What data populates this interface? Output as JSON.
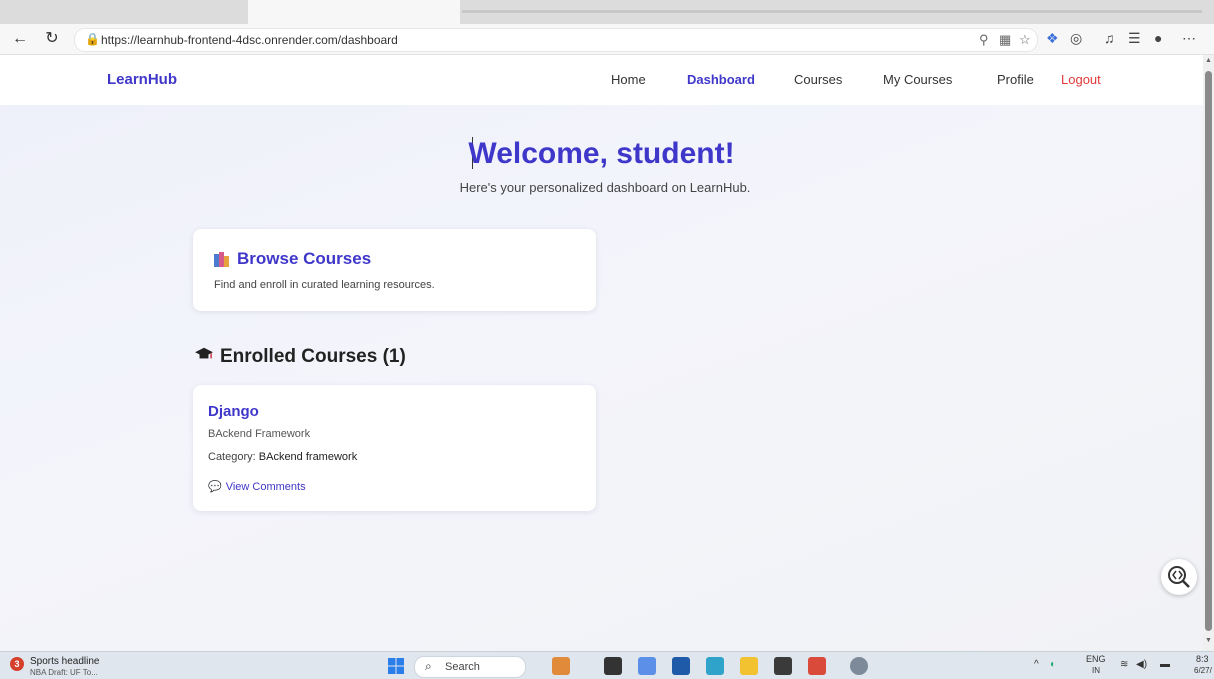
{
  "browser": {
    "url": "https://learnhub-frontend-4dsc.onrender.com/dashboard"
  },
  "nav": {
    "brand": "LearnHub",
    "links": [
      {
        "label": "Home"
      },
      {
        "label": "Dashboard"
      },
      {
        "label": "Courses"
      },
      {
        "label": "My Courses"
      },
      {
        "label": "Profile"
      },
      {
        "label": "Logout"
      }
    ]
  },
  "hero": {
    "title": "Welcome, student!",
    "subtitle": "Here's your personalized dashboard on LearnHub."
  },
  "browse_card": {
    "icon": "books-icon",
    "title": "Browse Courses",
    "description": "Find and enroll in curated learning resources."
  },
  "enrolled": {
    "icon": "graduation-cap-icon",
    "heading": "Enrolled Courses (1)",
    "courses": [
      {
        "name": "Django",
        "description": "BAckend Framework",
        "category_label": "Category:",
        "category_value": "BAckend framework",
        "comments_label": "View Comments"
      }
    ]
  },
  "taskbar": {
    "news_badge": "3",
    "news_title": "Sports headline",
    "news_sub": "NBA Draft: UF To...",
    "search_label": "Search",
    "lang": "ENG",
    "lang_sub": "IN",
    "time": "8:3",
    "date": "6/27/"
  },
  "colors": {
    "accent": "#3f37c9",
    "logout": "#e03b3b"
  }
}
